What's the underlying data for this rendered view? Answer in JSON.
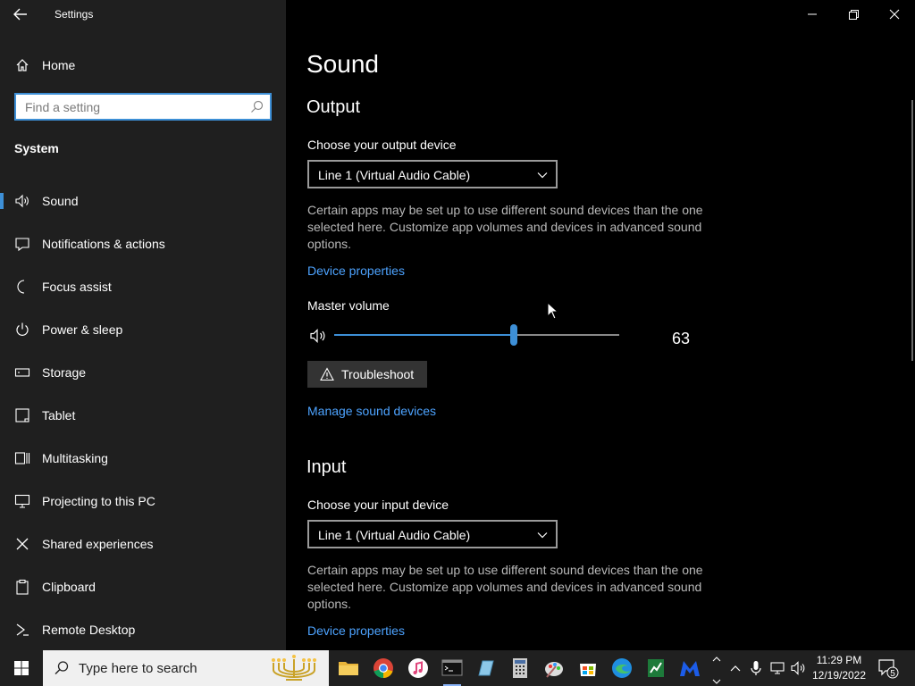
{
  "window": {
    "title": "Settings",
    "back_label": "Back",
    "minimize": "Minimize",
    "restore": "Restore",
    "close": "Close"
  },
  "sidebar": {
    "home_label": "Home",
    "search_placeholder": "Find a setting",
    "section_title": "System",
    "items": [
      {
        "label": "Sound",
        "icon": "speaker-icon",
        "active": true
      },
      {
        "label": "Notifications & actions",
        "icon": "notifications-icon"
      },
      {
        "label": "Focus assist",
        "icon": "moon-icon"
      },
      {
        "label": "Power & sleep",
        "icon": "power-icon"
      },
      {
        "label": "Storage",
        "icon": "storage-icon"
      },
      {
        "label": "Tablet",
        "icon": "tablet-icon"
      },
      {
        "label": "Multitasking",
        "icon": "multitasking-icon"
      },
      {
        "label": "Projecting to this PC",
        "icon": "projecting-icon"
      },
      {
        "label": "Shared experiences",
        "icon": "shared-experiences-icon"
      },
      {
        "label": "Clipboard",
        "icon": "clipboard-icon"
      },
      {
        "label": "Remote Desktop",
        "icon": "remote-desktop-icon"
      }
    ]
  },
  "main": {
    "page_title": "Sound",
    "output": {
      "heading": "Output",
      "device_label": "Choose your output device",
      "device_value": "Line 1 (Virtual Audio Cable)",
      "description": "Certain apps may be set up to use different sound devices than the one selected here. Customize app volumes and devices in advanced sound options.",
      "device_properties_link": "Device properties",
      "master_volume_label": "Master volume",
      "master_volume_value": "63",
      "master_volume_level": 63,
      "troubleshoot_label": "Troubleshoot",
      "manage_devices_link": "Manage sound devices"
    },
    "input": {
      "heading": "Input",
      "device_label": "Choose your input device",
      "device_value": "Line 1 (Virtual Audio Cable)",
      "description": "Certain apps may be set up to use different sound devices than the one selected here. Customize app volumes and devices in advanced sound options.",
      "device_properties_link": "Device properties"
    }
  },
  "taskbar": {
    "search_placeholder": "Type here to search",
    "apps": [
      "file-explorer-icon",
      "chrome-icon",
      "itunes-icon",
      "terminal-icon",
      "notepad-icon",
      "calculator-icon",
      "paint-icon",
      "store-icon",
      "edge-icon",
      "spreadsheet-icon",
      "malwarebytes-icon"
    ],
    "clock_time": "11:29 PM",
    "clock_date": "12/19/2022",
    "notification_count": "5"
  },
  "colors": {
    "accent": "#3d8fd6",
    "link": "#4da3ff",
    "sidebar_bg": "#1f1f1f",
    "content_bg": "#000000"
  }
}
